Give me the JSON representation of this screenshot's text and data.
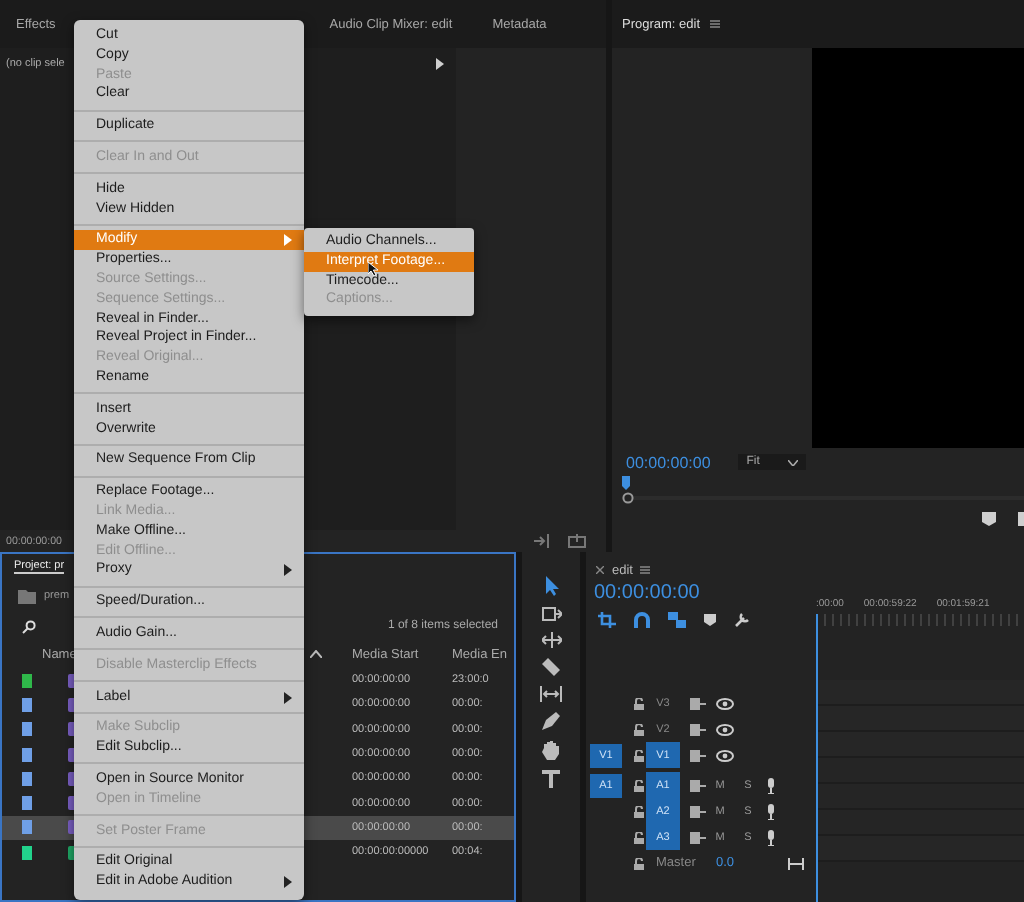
{
  "source_panel": {
    "tabs": [
      {
        "label": "Effects",
        "selected": false
      },
      {
        "label": "Audio Clip Mixer: edit",
        "selected": false
      },
      {
        "label": "Metadata",
        "selected": false
      }
    ],
    "clip_label": "(no clip sele",
    "timecode": "00:00:00:00"
  },
  "program_monitor": {
    "title": "Program: edit",
    "timecode": "00:00:00:00",
    "zoom": "Fit"
  },
  "project_panel": {
    "tab": "Project: pr",
    "bin": "prem",
    "selection_count": "1 of 8 items selected",
    "columns": [
      "Name",
      "Media Start",
      "Media En"
    ],
    "rows": [
      {
        "color": "#2fb84a",
        "media_start": "00:00:00:00",
        "media_end": "23:00:0",
        "selected": false
      },
      {
        "color": "#6f9fe6",
        "media_start": "00:00:00:00",
        "media_end": "00:00:",
        "selected": false
      },
      {
        "color": "#6f9fe6",
        "media_start": "00:00:00:00",
        "media_end": "00:00:",
        "selected": false
      },
      {
        "color": "#6f9fe6",
        "media_start": "00:00:00:00",
        "media_end": "00:00:",
        "selected": false
      },
      {
        "color": "#6f9fe6",
        "media_start": "00:00:00:00",
        "media_end": "00:00:",
        "selected": false
      },
      {
        "color": "#6f9fe6",
        "media_start": "00:00:00:00",
        "media_end": "00:00:",
        "selected": false
      },
      {
        "color": "#6f9fe6",
        "media_start": "00:00:00:00",
        "media_end": "00:00:",
        "selected": true
      },
      {
        "color": "#22d38c",
        "media_start": "00:00:00:00000",
        "media_end": "00:04:",
        "selected": false
      }
    ]
  },
  "timeline": {
    "sequence": "edit",
    "timecode": "00:00:00:00",
    "ruler": [
      ":00:00",
      "00:00:59:22",
      "00:01:59:21"
    ],
    "tracks": [
      {
        "kind": "video",
        "name": "V3",
        "targeted": false
      },
      {
        "kind": "video",
        "name": "V2",
        "targeted": false
      },
      {
        "kind": "video",
        "source": "V1",
        "name": "V1",
        "targeted": true
      },
      {
        "kind": "audio",
        "source": "A1",
        "name": "A1",
        "targeted": true,
        "mute": "M",
        "solo": "S"
      },
      {
        "kind": "audio",
        "name": "A2",
        "targeted": true,
        "mute": "M",
        "solo": "S"
      },
      {
        "kind": "audio",
        "name": "A3",
        "targeted": true,
        "mute": "M",
        "solo": "S"
      }
    ],
    "master": {
      "name": "Master",
      "value": "0.0"
    }
  },
  "context_menu": {
    "groups": [
      [
        {
          "label": "Cut",
          "disabled": false,
          "selected": false,
          "submenu": false
        },
        {
          "label": "Copy",
          "disabled": false,
          "selected": false,
          "submenu": false
        },
        {
          "label": "Paste",
          "disabled": true,
          "selected": false,
          "submenu": false
        },
        {
          "label": "Clear",
          "disabled": false,
          "selected": false,
          "submenu": false
        }
      ],
      [
        {
          "label": "Duplicate",
          "disabled": false,
          "selected": false,
          "submenu": false
        }
      ],
      [
        {
          "label": "Clear In and Out",
          "disabled": true,
          "selected": false,
          "submenu": false
        }
      ],
      [
        {
          "label": "Hide",
          "disabled": false,
          "selected": false,
          "submenu": false
        },
        {
          "label": "View Hidden",
          "disabled": false,
          "selected": false,
          "submenu": false
        }
      ],
      [
        {
          "label": "Modify",
          "disabled": false,
          "selected": true,
          "submenu": true
        },
        {
          "label": "Properties...",
          "disabled": false,
          "selected": false,
          "submenu": false
        },
        {
          "label": "Source Settings...",
          "disabled": true,
          "selected": false,
          "submenu": false
        },
        {
          "label": "Sequence Settings...",
          "disabled": true,
          "selected": false,
          "submenu": false
        },
        {
          "label": "Reveal in Finder...",
          "disabled": false,
          "selected": false,
          "submenu": false
        },
        {
          "label": "Reveal Project in Finder...",
          "disabled": false,
          "selected": false,
          "submenu": false
        },
        {
          "label": "Reveal Original...",
          "disabled": true,
          "selected": false,
          "submenu": false
        },
        {
          "label": "Rename",
          "disabled": false,
          "selected": false,
          "submenu": false
        }
      ],
      [
        {
          "label": "Insert",
          "disabled": false,
          "selected": false,
          "submenu": false
        },
        {
          "label": "Overwrite",
          "disabled": false,
          "selected": false,
          "submenu": false
        }
      ],
      [
        {
          "label": "New Sequence From Clip",
          "disabled": false,
          "selected": false,
          "submenu": false
        }
      ],
      [
        {
          "label": "Replace Footage...",
          "disabled": false,
          "selected": false,
          "submenu": false
        },
        {
          "label": "Link Media...",
          "disabled": true,
          "selected": false,
          "submenu": false
        },
        {
          "label": "Make Offline...",
          "disabled": false,
          "selected": false,
          "submenu": false
        },
        {
          "label": "Edit Offline...",
          "disabled": true,
          "selected": false,
          "submenu": false
        },
        {
          "label": "Proxy",
          "disabled": false,
          "selected": false,
          "submenu": true
        }
      ],
      [
        {
          "label": "Speed/Duration...",
          "disabled": false,
          "selected": false,
          "submenu": false
        }
      ],
      [
        {
          "label": "Audio Gain...",
          "disabled": false,
          "selected": false,
          "submenu": false
        }
      ],
      [
        {
          "label": "Disable Masterclip Effects",
          "disabled": true,
          "selected": false,
          "submenu": false
        }
      ],
      [
        {
          "label": "Label",
          "disabled": false,
          "selected": false,
          "submenu": true
        }
      ],
      [
        {
          "label": "Make Subclip",
          "disabled": true,
          "selected": false,
          "submenu": false
        },
        {
          "label": "Edit Subclip...",
          "disabled": false,
          "selected": false,
          "submenu": false
        }
      ],
      [
        {
          "label": "Open in Source Monitor",
          "disabled": false,
          "selected": false,
          "submenu": false
        },
        {
          "label": "Open in Timeline",
          "disabled": true,
          "selected": false,
          "submenu": false
        }
      ],
      [
        {
          "label": "Set Poster Frame",
          "disabled": true,
          "selected": false,
          "submenu": false
        }
      ],
      [
        {
          "label": "Edit Original",
          "disabled": false,
          "selected": false,
          "submenu": false
        },
        {
          "label": "Edit in Adobe Audition",
          "disabled": false,
          "selected": false,
          "submenu": true
        }
      ]
    ]
  },
  "submenu": {
    "items": [
      {
        "label": "Audio Channels...",
        "disabled": false,
        "selected": false
      },
      {
        "label": "Interpret Footage...",
        "disabled": false,
        "selected": true
      },
      {
        "label": "Timecode...",
        "disabled": false,
        "selected": false
      },
      {
        "label": "Captions...",
        "disabled": true,
        "selected": false
      }
    ]
  }
}
